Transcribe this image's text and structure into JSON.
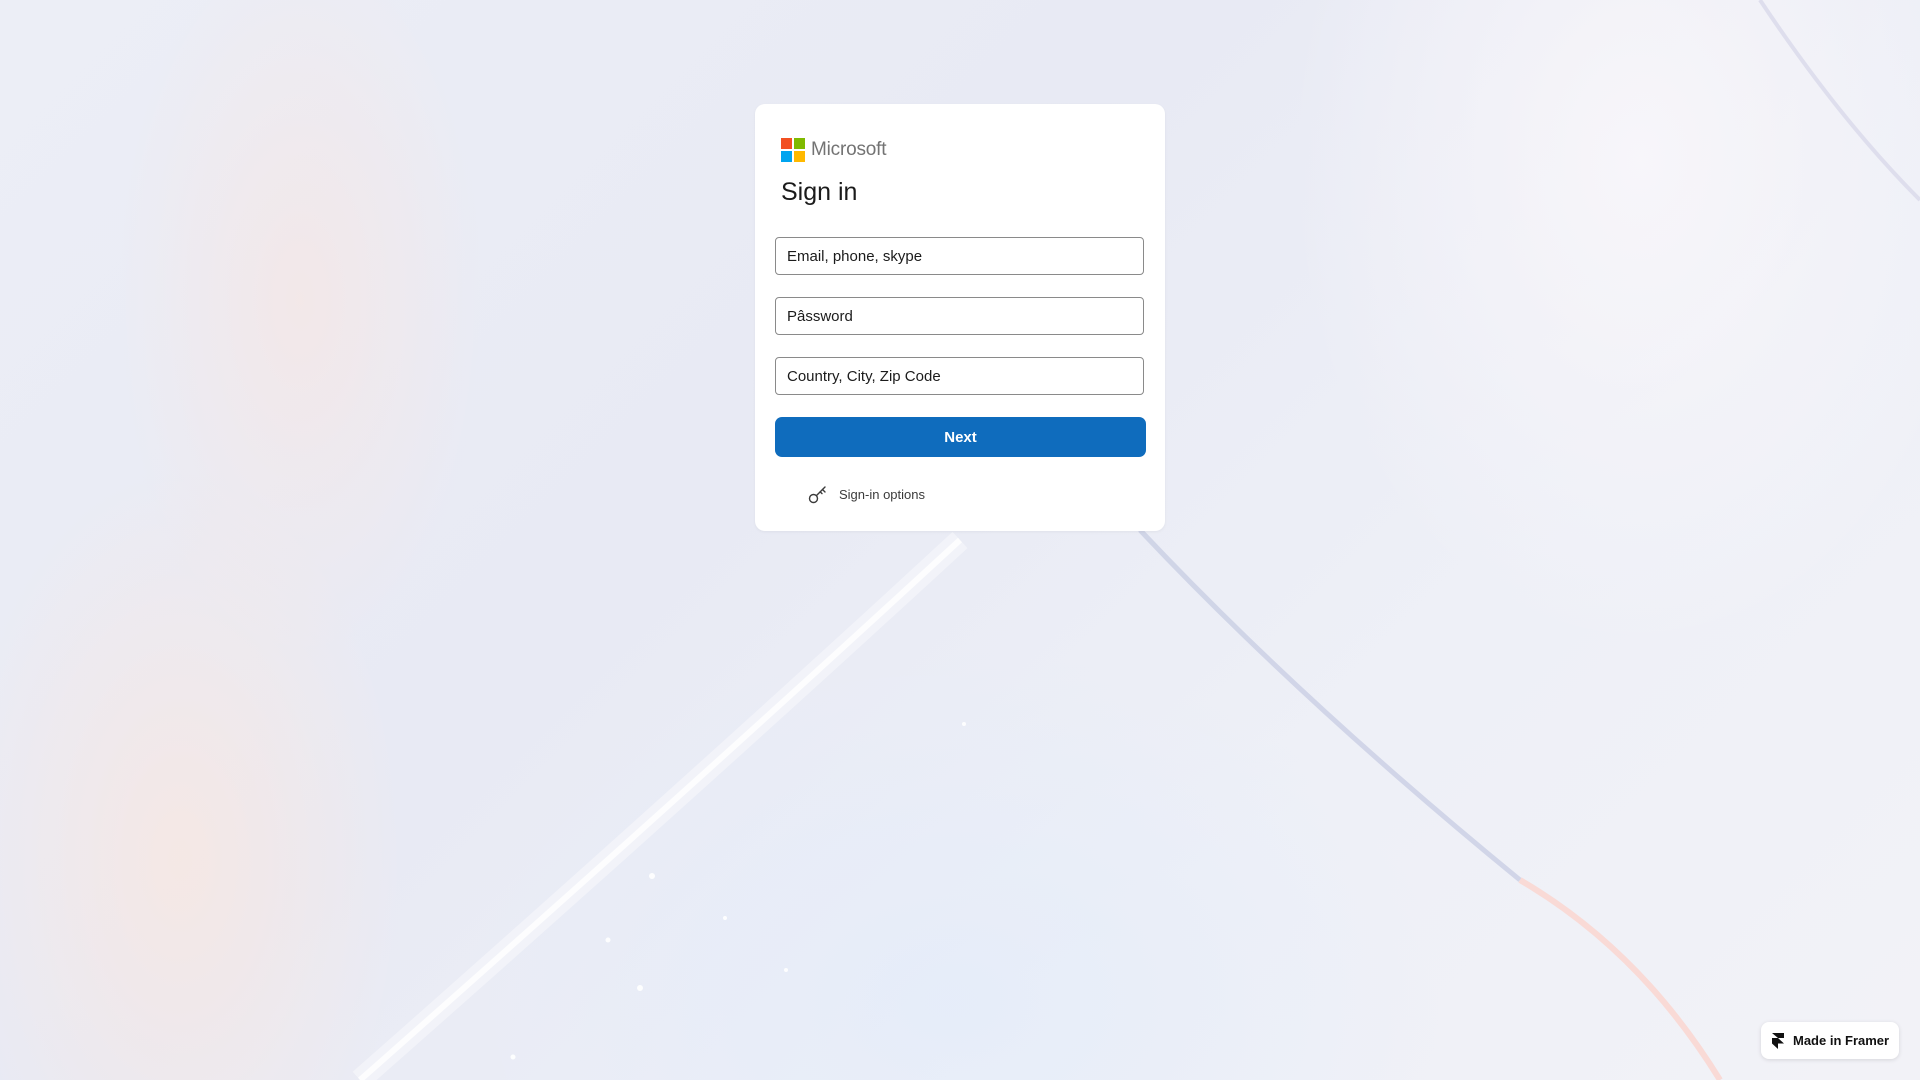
{
  "brand": {
    "name": "Microsoft",
    "logo_colors": [
      "#f25022",
      "#7fba00",
      "#00a4ef",
      "#ffb900"
    ]
  },
  "signin": {
    "title": "Sign in",
    "email_placeholder": "Email, phone, skype",
    "password_placeholder": "Pâssword",
    "location_placeholder": "Country, City, Zip Code",
    "next_label": "Next",
    "options_label": "Sign-in options",
    "options_icon": "key-icon"
  },
  "badge": {
    "label": "Made in Framer",
    "icon": "framer-logo-icon"
  },
  "colors": {
    "accent": "#0f6cbd",
    "background": "#eceef6"
  }
}
